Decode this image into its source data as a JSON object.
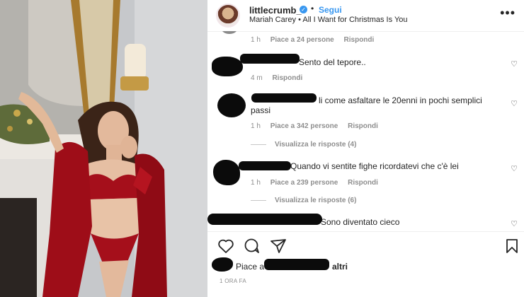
{
  "post": {
    "username": "littlecrumb_",
    "separator": "•",
    "follow_label": "Segui",
    "song": "Mariah Carey • All I Want for Christmas Is You",
    "more_icon": "more-options-icon",
    "verified_icon": "verified-badge-icon"
  },
  "comments": [
    {
      "text": "",
      "time": "1 h",
      "likes": "Piace a 24 persone",
      "reply": "Rispondi"
    },
    {
      "text": "Sento del tepore..",
      "time": "4 m",
      "reply": "Rispondi"
    },
    {
      "text_line1": "li come asfaltare le 20enni in pochi semplici",
      "text_line2": "passi",
      "time": "1 h",
      "likes": "Piace a 342 persone",
      "reply": "Rispondi",
      "view_replies": "Visualizza le risposte (4)"
    },
    {
      "text": "Quando vi sentite fighe ricordatevi che c'è lei",
      "time": "1 h",
      "likes": "Piace a 239 persone",
      "reply": "Rispondi",
      "view_replies": "Visualizza le risposte (6)"
    },
    {
      "text": "Sono diventato cieco"
    }
  ],
  "likes": {
    "prefix": "Piace a",
    "suffix": "altri"
  },
  "timestamp": "1 ORA FA",
  "colors": {
    "accent": "#3897f0",
    "dress": "#a50f1b",
    "text": "#262626",
    "muted": "#8e8e8e"
  }
}
